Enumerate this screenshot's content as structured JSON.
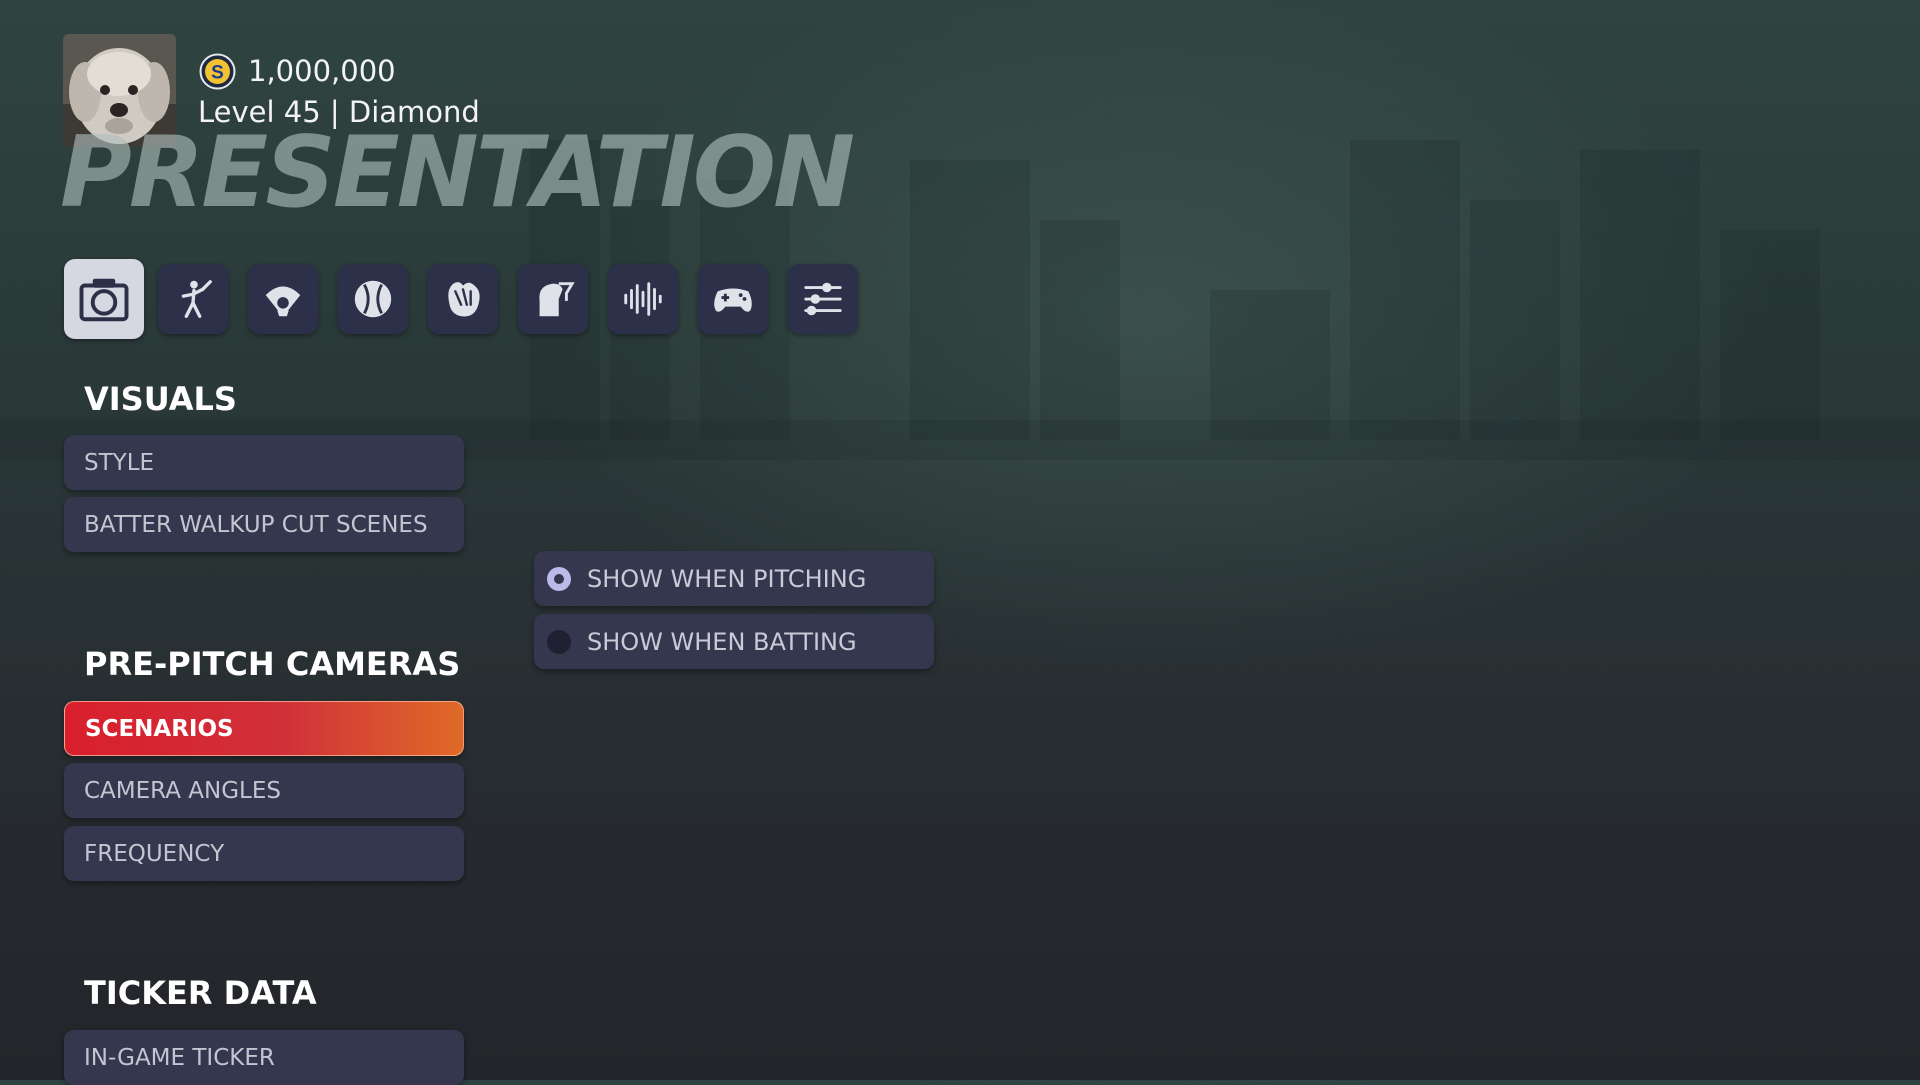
{
  "profile": {
    "avatar_icon": "dog-avatar",
    "coin_icon": "stubs-coin-icon",
    "currency": "1,000,000",
    "level_text": "Level 45 | Diamond"
  },
  "page_title": "PRESENTATION",
  "tabs": [
    {
      "icon": "camera-icon",
      "active": true
    },
    {
      "icon": "batter-icon",
      "active": false
    },
    {
      "icon": "umpire-icon",
      "active": false
    },
    {
      "icon": "baseball-icon",
      "active": false
    },
    {
      "icon": "glove-icon",
      "active": false
    },
    {
      "icon": "head-strategy-icon",
      "active": false
    },
    {
      "icon": "audio-waveform-icon",
      "active": false
    },
    {
      "icon": "controller-icon",
      "active": false
    },
    {
      "icon": "sliders-icon",
      "active": false
    }
  ],
  "sections": {
    "visuals": {
      "title": "VISUALS",
      "items": [
        "STYLE",
        "BATTER WALKUP CUT SCENES"
      ]
    },
    "pre_pitch": {
      "title": "PRE-PITCH CAMERAS",
      "items": [
        "SCENARIOS",
        "CAMERA ANGLES",
        "FREQUENCY"
      ],
      "selected": "SCENARIOS"
    },
    "ticker": {
      "title": "TICKER DATA",
      "items": [
        "IN-GAME TICKER"
      ]
    }
  },
  "options": [
    {
      "label": "SHOW WHEN PITCHING",
      "checked": true
    },
    {
      "label": "SHOW WHEN BATTING",
      "checked": false
    }
  ],
  "colors": {
    "accent_red": "#d91f2d",
    "accent_orange": "#df6a27",
    "button_bg": "#35374e",
    "radio_on": "#b9bbe8"
  }
}
